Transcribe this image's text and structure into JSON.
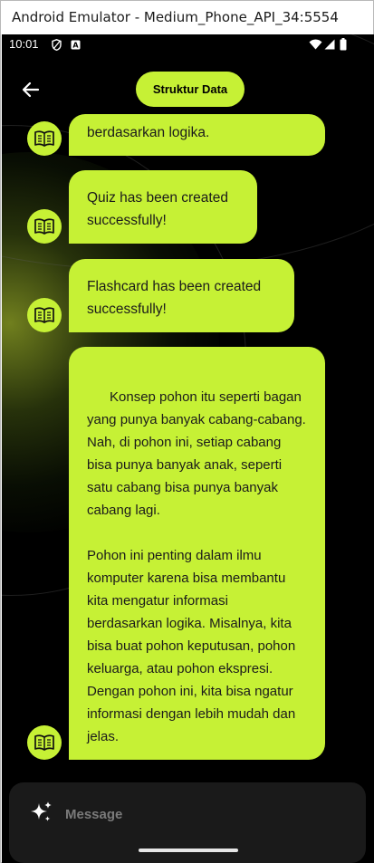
{
  "window": {
    "title": "Android Emulator - Medium_Phone_API_34:5554"
  },
  "status_bar": {
    "time": "10:01",
    "left_icons": [
      "shield-icon",
      "a-badge-icon"
    ],
    "right_icons": [
      "wifi-icon",
      "signal-icon",
      "battery-icon"
    ]
  },
  "header": {
    "title": "Struktur Data",
    "back_icon": "arrow-left-icon"
  },
  "messages": [
    {
      "text": "berdasarkan logika."
    },
    {
      "text": "Quiz has been created successfully!"
    },
    {
      "text": "Flashcard has been created successfully!"
    },
    {
      "text": "Konsep pohon itu seperti bagan yang punya banyak cabang-cabang. Nah, di pohon ini, setiap cabang bisa punya banyak anak, seperti satu cabang bisa punya banyak cabang lagi.\n\nPohon ini penting dalam ilmu komputer karena bisa membantu kita mengatur informasi berdasarkan logika. Misalnya, kita bisa buat pohon keputusan, pohon keluarga, atau pohon ekspresi. Dengan pohon ini, kita bisa ngatur informasi dengan lebih mudah dan jelas."
    }
  ],
  "avatar_icon": "open-book-icon",
  "composer": {
    "placeholder": "Message",
    "icon": "sparkle-icon"
  },
  "colors": {
    "accent": "#c6f135",
    "background": "#000000",
    "composer": "#1a1a1a"
  }
}
